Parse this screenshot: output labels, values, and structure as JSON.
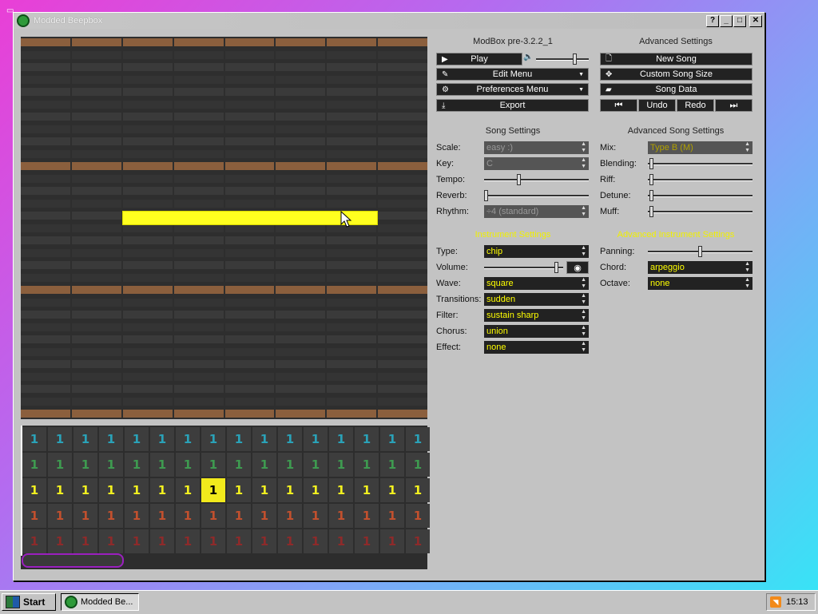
{
  "window": {
    "title": "Modded Beepbox"
  },
  "panel": {
    "version": "ModBox pre-3.2.2_1",
    "advanced_title": "Advanced Settings",
    "play": "Play",
    "edit_menu": "Edit Menu",
    "preferences_menu": "Preferences Menu",
    "export": "Export",
    "new_song": "New Song",
    "custom_song_size": "Custom Song Size",
    "song_data": "Song Data",
    "undo": "Undo",
    "redo": "Redo",
    "song_settings": "Song Settings",
    "advanced_song_settings": "Advanced Song Settings",
    "instrument_settings": "Instrument Settings",
    "advanced_instrument_settings": "Advanced Instrument Settings",
    "accent_color": "#f0f000"
  },
  "song": {
    "scale_label": "Scale:",
    "scale_value": "easy :)",
    "key_label": "Key:",
    "key_value": "C",
    "tempo_label": "Tempo:",
    "tempo_level": 0.33,
    "reverb_label": "Reverb:",
    "reverb_level": 0.0,
    "rhythm_label": "Rhythm:",
    "rhythm_value": "÷4 (standard)"
  },
  "adv_song": {
    "mix_label": "Mix:",
    "mix_value": "Type B (M)",
    "blending_label": "Blending:",
    "riff_label": "Riff:",
    "detune_label": "Detune:",
    "muff_label": "Muff:"
  },
  "instrument": {
    "type_label": "Type:",
    "type_value": "chip",
    "volume_label": "Volume:",
    "volume_level": 0.95,
    "wave_label": "Wave:",
    "wave_value": "square",
    "transitions_label": "Transitions:",
    "transitions_value": "sudden",
    "filter_label": "Filter:",
    "filter_value": "sustain sharp",
    "chorus_label": "Chorus:",
    "chorus_value": "union",
    "effect_label": "Effect:",
    "effect_value": "none"
  },
  "adv_instrument": {
    "panning_label": "Panning:",
    "panning_level": 0.5,
    "chord_label": "Chord:",
    "chord_value": "arpeggio",
    "octave_label": "Octave:",
    "octave_value": "none"
  },
  "pattern": {
    "rows": [
      {
        "color": "#2aa2b8",
        "cells": [
          "1",
          "1",
          "1",
          "1",
          "1",
          "1",
          "1",
          "1",
          "1",
          "1",
          "1",
          "1",
          "1",
          "1",
          "1",
          "1"
        ]
      },
      {
        "color": "#3e9a50",
        "cells": [
          "1",
          "1",
          "1",
          "1",
          "1",
          "1",
          "1",
          "1",
          "1",
          "1",
          "1",
          "1",
          "1",
          "1",
          "1",
          "1"
        ]
      },
      {
        "color": "#f2f020",
        "cells": [
          "1",
          "1",
          "1",
          "1",
          "1",
          "1",
          "1",
          "1",
          "1",
          "1",
          "1",
          "1",
          "1",
          "1",
          "1",
          "1"
        ]
      },
      {
        "color": "#c2502e",
        "cells": [
          "1",
          "1",
          "1",
          "1",
          "1",
          "1",
          "1",
          "1",
          "1",
          "1",
          "1",
          "1",
          "1",
          "1",
          "1",
          "1"
        ]
      },
      {
        "color": "#8e2a2a",
        "cells": [
          "1",
          "1",
          "1",
          "1",
          "1",
          "1",
          "1",
          "1",
          "1",
          "1",
          "1",
          "1",
          "1",
          "1",
          "1",
          "1"
        ]
      }
    ],
    "selected_row": 2,
    "selected_col": 7
  },
  "taskbar": {
    "start": "Start",
    "task_label": "Modded Be...",
    "clock": "15:13"
  }
}
